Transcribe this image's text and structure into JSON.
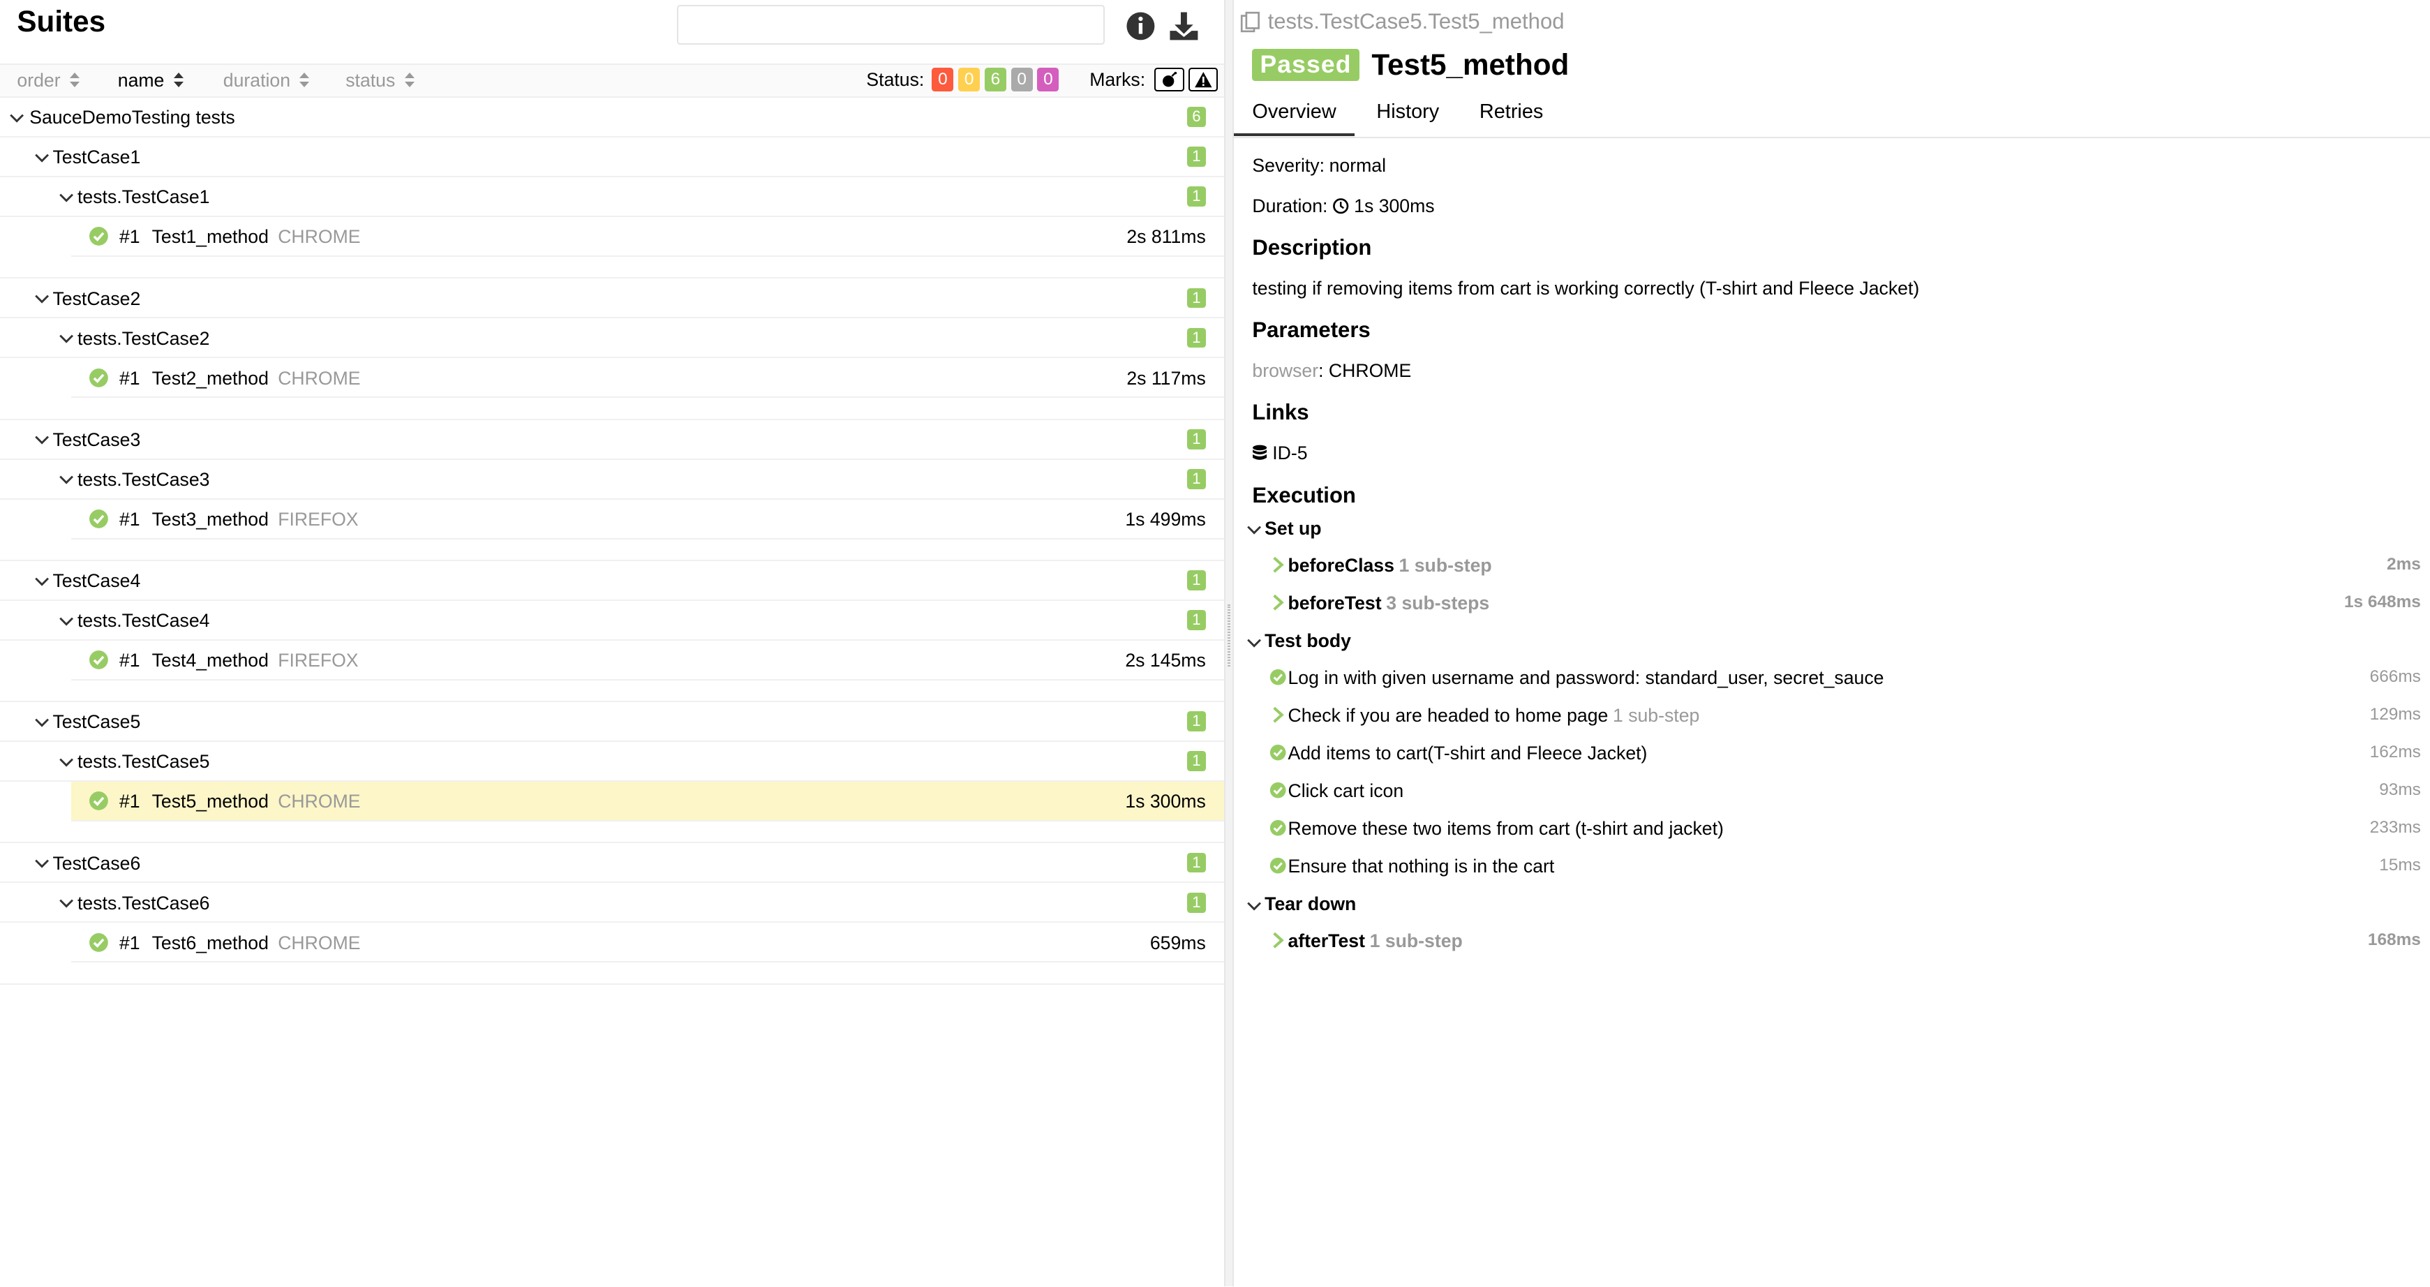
{
  "left": {
    "title": "Suites",
    "search": {
      "value": "",
      "placeholder": ""
    },
    "sort": {
      "order": "order",
      "name": "name",
      "duration": "duration",
      "status": "status"
    },
    "status_filter": {
      "label": "Status:",
      "counts": [
        {
          "value": "0",
          "color": "#fd5a3e"
        },
        {
          "value": "0",
          "color": "#ffd050"
        },
        {
          "value": "6",
          "color": "#97cc64"
        },
        {
          "value": "0",
          "color": "#aaaaaa"
        },
        {
          "value": "0",
          "color": "#d35ebe"
        }
      ]
    },
    "marks_label": "Marks:",
    "root": {
      "label": "SauceDemoTesting tests",
      "count": "6"
    },
    "suites": [
      {
        "name": "TestCase1",
        "count": "1",
        "cls": "tests.TestCase1",
        "cls_count": "1",
        "test": {
          "num": "#1",
          "name": "Test1_method",
          "browser": "CHROME",
          "duration": "2s 811ms"
        }
      },
      {
        "name": "TestCase2",
        "count": "1",
        "cls": "tests.TestCase2",
        "cls_count": "1",
        "test": {
          "num": "#1",
          "name": "Test2_method",
          "browser": "CHROME",
          "duration": "2s 117ms"
        }
      },
      {
        "name": "TestCase3",
        "count": "1",
        "cls": "tests.TestCase3",
        "cls_count": "1",
        "test": {
          "num": "#1",
          "name": "Test3_method",
          "browser": "FIREFOX",
          "duration": "1s 499ms"
        }
      },
      {
        "name": "TestCase4",
        "count": "1",
        "cls": "tests.TestCase4",
        "cls_count": "1",
        "test": {
          "num": "#1",
          "name": "Test4_method",
          "browser": "FIREFOX",
          "duration": "2s 145ms"
        }
      },
      {
        "name": "TestCase5",
        "count": "1",
        "cls": "tests.TestCase5",
        "cls_count": "1",
        "test": {
          "num": "#1",
          "name": "Test5_method",
          "browser": "CHROME",
          "duration": "1s 300ms"
        }
      },
      {
        "name": "TestCase6",
        "count": "1",
        "cls": "tests.TestCase6",
        "cls_count": "1",
        "test": {
          "num": "#1",
          "name": "Test6_method",
          "browser": "CHROME",
          "duration": "659ms"
        }
      }
    ],
    "selected_index": 4
  },
  "right": {
    "breadcrumb": "tests.TestCase5.Test5_method",
    "status": "Passed",
    "status_color": "#97cc64",
    "title": "Test5_method",
    "tabs": [
      "Overview",
      "History",
      "Retries"
    ],
    "severity_label": "Severity:",
    "severity": "normal",
    "duration_label": "Duration:",
    "duration": "1s 300ms",
    "description_title": "Description",
    "description": "testing if removing items from cart is working correctly (T-shirt and Fleece Jacket)",
    "parameters_title": "Parameters",
    "param_key": "browser",
    "param_value": ": CHROME",
    "links_title": "Links",
    "link": "ID-5",
    "execution_title": "Execution",
    "setup": {
      "label": "Set up",
      "steps": [
        {
          "name": "beforeClass",
          "sub": "1 sub-step",
          "duration": "2ms"
        },
        {
          "name": "beforeTest",
          "sub": "3 sub-steps",
          "duration": "1s 648ms"
        }
      ]
    },
    "body": {
      "label": "Test body",
      "steps": [
        {
          "name": "Log in with given username and password: standard_user, secret_sauce",
          "sub": "",
          "duration": "666ms",
          "icon": "check"
        },
        {
          "name": "Check if you are headed to home page",
          "sub": "1 sub-step",
          "duration": "129ms",
          "icon": "chevron"
        },
        {
          "name": "Add items to cart(T-shirt and Fleece Jacket)",
          "sub": "",
          "duration": "162ms",
          "icon": "check"
        },
        {
          "name": "Click cart icon",
          "sub": "",
          "duration": "93ms",
          "icon": "check"
        },
        {
          "name": "Remove these two items from cart (t-shirt and jacket)",
          "sub": "",
          "duration": "233ms",
          "icon": "check"
        },
        {
          "name": "Ensure that nothing is in the cart",
          "sub": "",
          "duration": "15ms",
          "icon": "check"
        }
      ]
    },
    "teardown": {
      "label": "Tear down",
      "steps": [
        {
          "name": "afterTest",
          "sub": "1 sub-step",
          "duration": "168ms"
        }
      ]
    }
  }
}
